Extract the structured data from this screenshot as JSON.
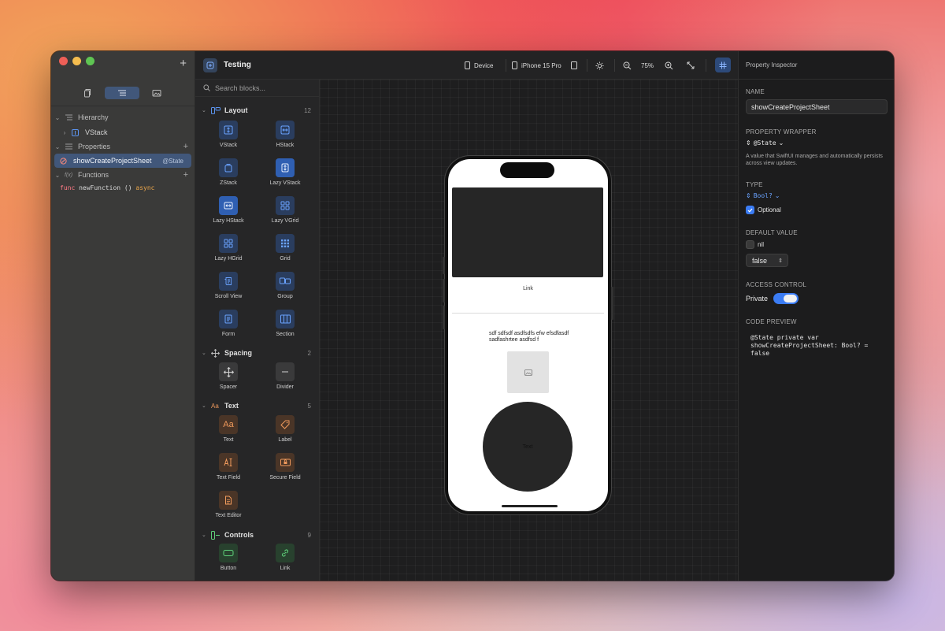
{
  "colors": {
    "accent": "#3b7cf4",
    "selection": "#41577a",
    "panel": "#1c1c1d"
  },
  "sidebar": {
    "hierarchy_label": "Hierarchy",
    "vstack_label": "VStack",
    "properties_label": "Properties",
    "property": {
      "name": "showCreateProjectSheet",
      "tag": "@State"
    },
    "functions_label": "Functions",
    "function": {
      "keyword": "func",
      "name": "newFunction",
      "parens": "()",
      "modifier": "async"
    }
  },
  "toolbar": {
    "title": "Testing",
    "device_label": "Device",
    "device_model": "iPhone 15 Pro",
    "zoom": "75%"
  },
  "library": {
    "search_placeholder": "Search blocks...",
    "categories": [
      {
        "name": "Layout",
        "count": "12",
        "blocks": [
          "VStack",
          "HStack",
          "ZStack",
          "Lazy VStack",
          "Lazy HStack",
          "Lazy VGrid",
          "Lazy HGrid",
          "Grid",
          "Scroll View",
          "Group",
          "Form",
          "Section"
        ]
      },
      {
        "name": "Spacing",
        "count": "2",
        "blocks": [
          "Spacer",
          "Divider"
        ]
      },
      {
        "name": "Text",
        "count": "5",
        "blocks": [
          "Text",
          "Label",
          "Text Field",
          "Secure Field",
          "Text Editor"
        ]
      },
      {
        "name": "Controls",
        "count": "9",
        "blocks": [
          "Button",
          "Link"
        ]
      }
    ]
  },
  "preview": {
    "link_text": "Link",
    "paragraph": "sdf sdfsdf asdfsdfs efw efsdfasdf sadfashrtee asdfsd f",
    "circle_text": "Text"
  },
  "inspector": {
    "title": "Property Inspector",
    "name_label": "NAME",
    "name_value": "showCreateProjectSheet",
    "wrapper_label": "PROPERTY WRAPPER",
    "wrapper_value": "@State",
    "wrapper_desc": "A value that SwiftUI manages and automatically persists across view updates.",
    "type_label": "TYPE",
    "type_value": "Bool?",
    "optional_label": "Optional",
    "default_label": "DEFAULT VALUE",
    "nil_label": "nil",
    "default_value": "false",
    "access_label": "ACCESS CONTROL",
    "access_value": "Private",
    "code_label": "CODE PREVIEW",
    "code": "@State private var showCreateProjectSheet: Bool? = false"
  }
}
